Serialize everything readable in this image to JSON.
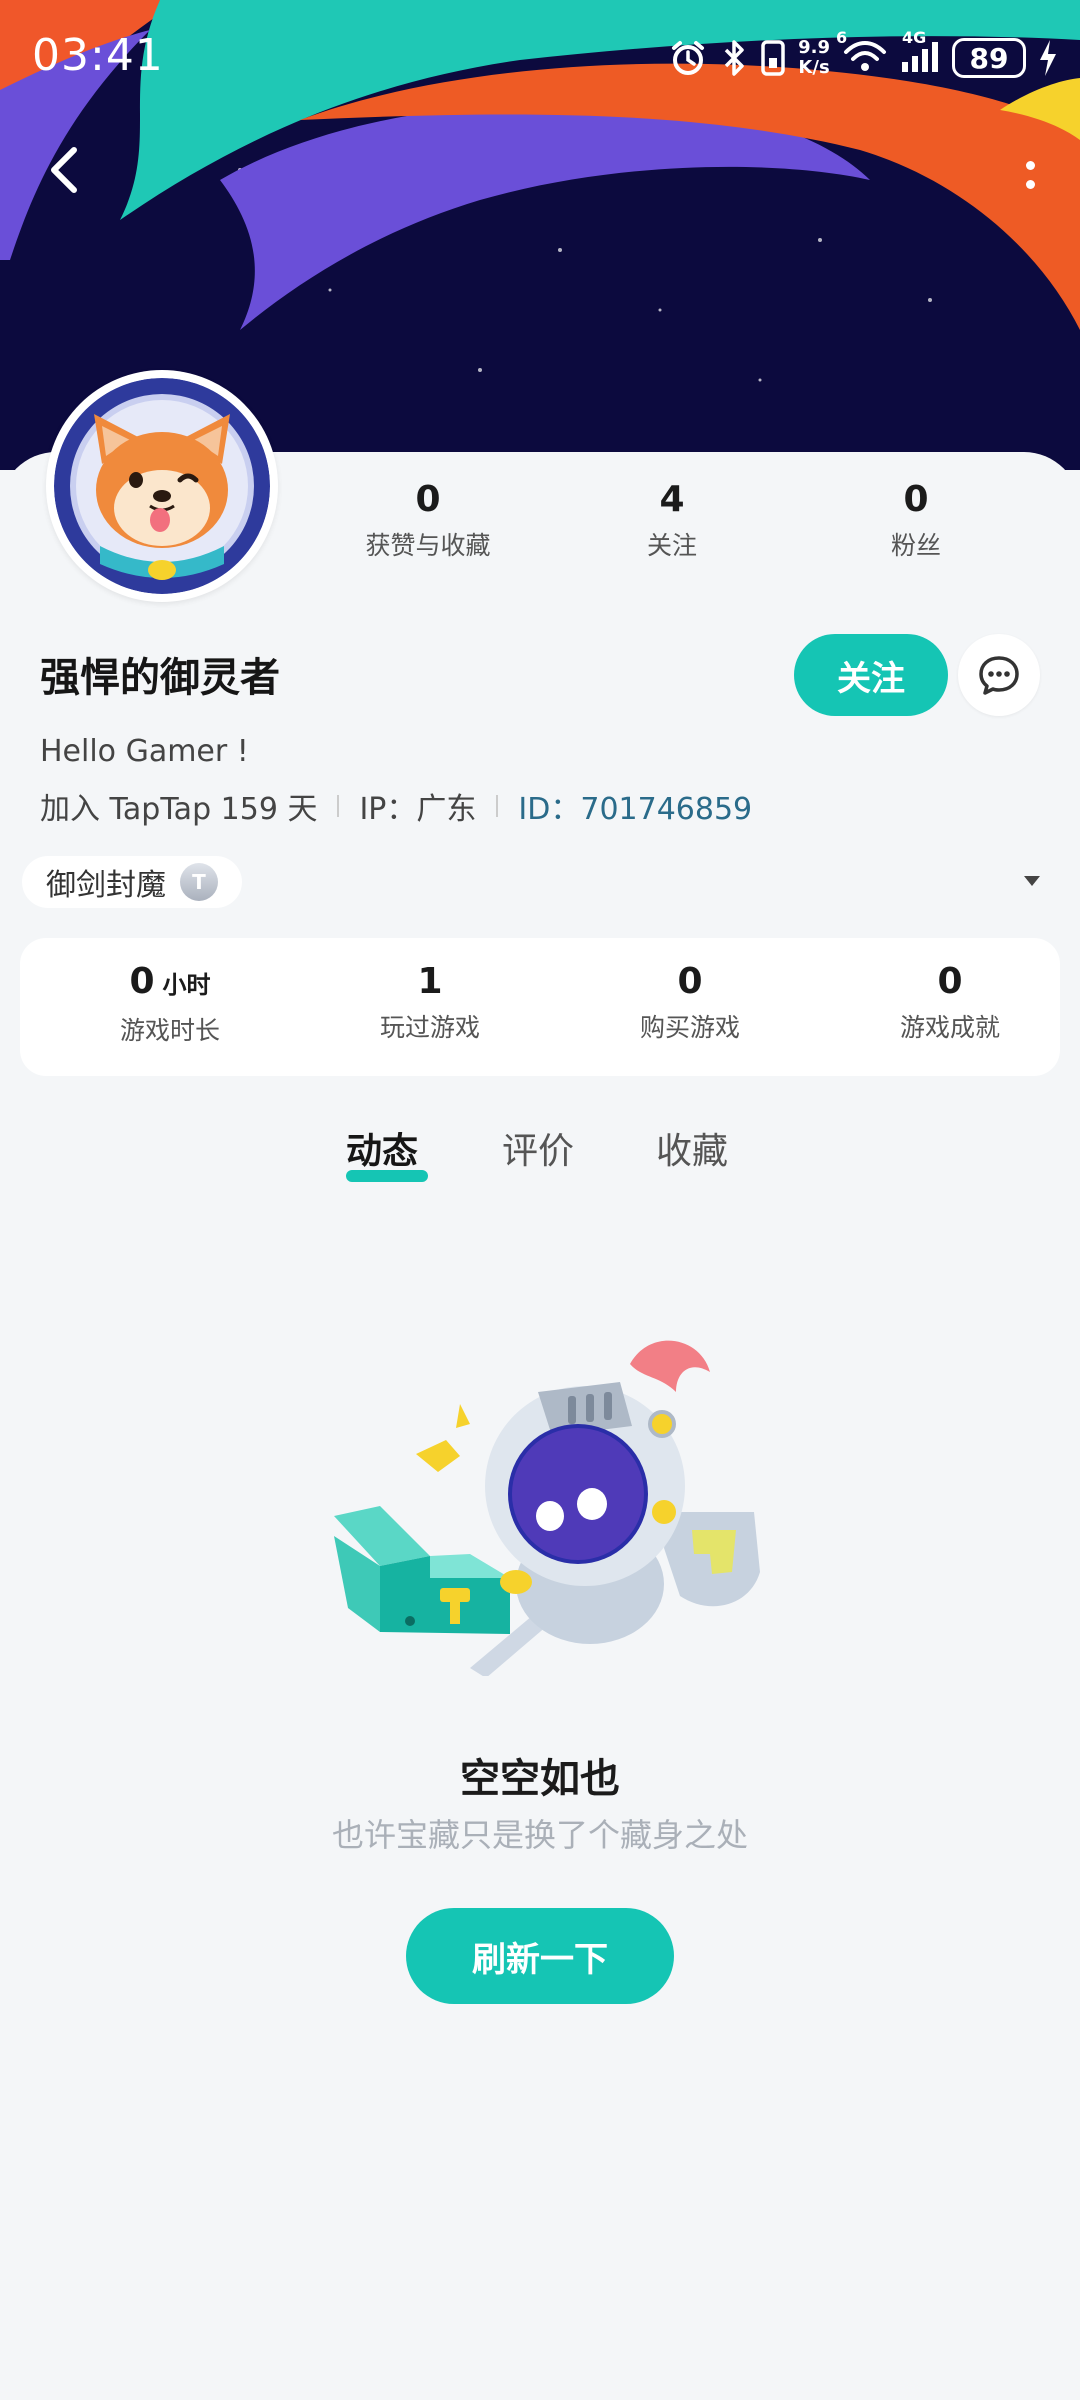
{
  "status_bar": {
    "time": "03:41",
    "net_speed_top": "9.9",
    "net_speed_bottom": "K/s",
    "wifi_tag": "6",
    "cell_tag": "4G",
    "battery": "89"
  },
  "profile": {
    "stats": [
      {
        "value": "0",
        "label": "获赞与收藏"
      },
      {
        "value": "4",
        "label": "关注"
      },
      {
        "value": "0",
        "label": "粉丝"
      }
    ],
    "username": "强悍的御灵者",
    "follow_label": "关注",
    "bio": "Hello Gamer !",
    "join_text": "加入 TapTap 159 天",
    "ip_text": "IP：广东",
    "id_text": "ID：701746859",
    "title_badge": "御剑封魔",
    "title_badge_icon": "T"
  },
  "game_stats": [
    {
      "value": "0",
      "unit": "小时",
      "label": "游戏时长"
    },
    {
      "value": "1",
      "label": "玩过游戏"
    },
    {
      "value": "0",
      "label": "购买游戏"
    },
    {
      "value": "0",
      "label": "游戏成就"
    }
  ],
  "tabs": [
    {
      "label": "动态",
      "active": true
    },
    {
      "label": "评价",
      "active": false
    },
    {
      "label": "收藏",
      "active": false
    }
  ],
  "empty_state": {
    "title": "空空如也",
    "subtitle": "也许宝藏只是换了个藏身之处",
    "button": "刷新一下"
  },
  "colors": {
    "accent": "#15c5b4",
    "banner_bg": "#0c0a3e",
    "id_link": "#2a6b8a"
  }
}
